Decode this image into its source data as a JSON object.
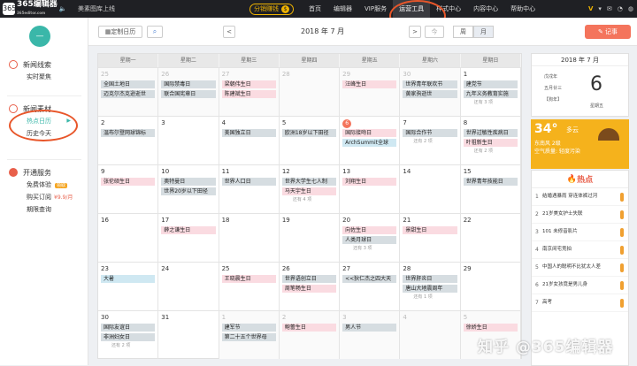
{
  "topbar": {
    "logo_mark": "365",
    "logo_text": "365编辑器",
    "logo_sub": "365editor.com",
    "notice": "美素图库上线",
    "earn_label": "分销赚钱",
    "coin": "$",
    "nav": [
      "首页",
      "编辑器",
      "VIP服务",
      "运营工具",
      "样式中心",
      "内容中心",
      "帮助中心"
    ],
    "right": {
      "vip": "V",
      "arrow": "▾"
    }
  },
  "sidebar": {
    "toggle": "—",
    "sections": [
      {
        "title": "新闻线索",
        "links": [
          "实时聚焦"
        ]
      },
      {
        "title": "新闻素材",
        "links": [
          "热点日历",
          "历史今天"
        ]
      },
      {
        "title": "开通服务",
        "links": [
          "免费体验",
          "购买订阅",
          "期限查询"
        ]
      }
    ],
    "free_badge": "领取",
    "price": "¥9.9/月"
  },
  "toolbar": {
    "custom_label": "定制日历",
    "search_icon": "⌕",
    "prev": "<",
    "month": "2018 年 7 月",
    "next": ">",
    "today": "今",
    "view_week": "周",
    "view_month": "月",
    "note": "记事"
  },
  "calendar": {
    "weekdays": [
      "星期一",
      "星期二",
      "星期三",
      "星期四",
      "星期五",
      "星期六",
      "星期日"
    ],
    "weeks": [
      [
        {
          "d": "25",
          "grey": true,
          "ev": [
            [
              "全国土地日",
              "grey"
            ],
            [
              "迈克尔杰克逊逝世",
              "grey"
            ]
          ]
        },
        {
          "d": "26",
          "grey": true,
          "ev": [
            [
              "国际禁毒日",
              "grey"
            ],
            [
              "联合国宪章日",
              "grey"
            ]
          ]
        },
        {
          "d": "27",
          "grey": true,
          "ev": [
            [
              "梁朝伟生日",
              "pink"
            ],
            [
              "陈建斌生日",
              "pink"
            ]
          ]
        },
        {
          "d": "28",
          "grey": true,
          "ev": []
        },
        {
          "d": "29",
          "grey": true,
          "ev": [
            [
              "汪峰生日",
              "pink"
            ]
          ]
        },
        {
          "d": "30",
          "grey": true,
          "ev": [
            [
              "世界青年联欢节",
              "grey"
            ],
            [
              "黄家驹逝世",
              "grey"
            ]
          ]
        },
        {
          "d": "1",
          "grey": false,
          "ev": [
            [
              "建党节",
              "grey"
            ],
            [
              "九年义务教育实施",
              "grey"
            ]
          ],
          "more": "还有 3 项"
        }
      ],
      [
        {
          "d": "2",
          "ev": [
            [
              "温布尔登网球锦标",
              "grey"
            ]
          ]
        },
        {
          "d": "3",
          "ev": []
        },
        {
          "d": "4",
          "ev": [
            [
              "美国独立日",
              "grey"
            ]
          ]
        },
        {
          "d": "5",
          "ev": [
            [
              "欧洲18岁以下田径",
              "grey"
            ]
          ]
        },
        {
          "d": "6",
          "today": true,
          "ev": [
            [
              "国际接吻日",
              "pink"
            ],
            [
              "ArchSummit全球",
              "blue"
            ]
          ]
        },
        {
          "d": "7",
          "ev": [
            [
              "国际合作节",
              "grey"
            ]
          ],
          "more": "还有 2 项"
        },
        {
          "d": "8",
          "ev": [
            [
              "世界过敏性疾病日",
              "grey"
            ],
            [
              "叶祖新生日",
              "pink"
            ]
          ],
          "more": "还有 2 项"
        }
      ],
      [
        {
          "d": "9",
          "ev": [
            [
              "张伦硕生日",
              "pink"
            ]
          ]
        },
        {
          "d": "10",
          "ev": [
            [
              "奥特曼日",
              "grey"
            ],
            [
              "世界20岁以下田径",
              "grey"
            ]
          ]
        },
        {
          "d": "11",
          "ev": [
            [
              "世界人口日",
              "grey"
            ]
          ]
        },
        {
          "d": "12",
          "ev": [
            [
              "世界大学生七人制",
              "grey"
            ],
            [
              "马天宇生日",
              "pink"
            ]
          ],
          "more": "还有 4 项"
        },
        {
          "d": "13",
          "ev": [
            [
              "刘翔生日",
              "pink"
            ]
          ]
        },
        {
          "d": "14",
          "ev": []
        },
        {
          "d": "15",
          "ev": [
            [
              "世界青年技能日",
              "grey"
            ]
          ]
        }
      ],
      [
        {
          "d": "16",
          "ev": []
        },
        {
          "d": "17",
          "ev": [
            [
              "薛之谦生日",
              "pink"
            ]
          ]
        },
        {
          "d": "18",
          "ev": []
        },
        {
          "d": "19",
          "ev": []
        },
        {
          "d": "20",
          "ev": [
            [
              "向佐生日",
              "pink"
            ],
            [
              "人类月球日",
              "grey"
            ]
          ],
          "more": "还有 3 项"
        },
        {
          "d": "21",
          "ev": [
            [
              "景甜生日",
              "pink"
            ]
          ]
        },
        {
          "d": "22",
          "ev": []
        }
      ],
      [
        {
          "d": "23",
          "ev": [
            [
              "大暑",
              "blue"
            ]
          ]
        },
        {
          "d": "24",
          "ev": []
        },
        {
          "d": "25",
          "ev": [
            [
              "王晓晨生日",
              "pink"
            ]
          ]
        },
        {
          "d": "26",
          "ev": [
            [
              "世界语创立日",
              "grey"
            ],
            [
              "周笔畅生日",
              "pink"
            ]
          ]
        },
        {
          "d": "27",
          "ev": [
            [
              "<<狄仁杰之四大天",
              "grey"
            ]
          ]
        },
        {
          "d": "28",
          "ev": [
            [
              "世界肝炎日",
              "grey"
            ],
            [
              "唐山大地震周年",
              "grey"
            ]
          ],
          "more": "还有 1 项"
        },
        {
          "d": "29",
          "ev": []
        }
      ],
      [
        {
          "d": "30",
          "ev": [
            [
              "国际友谊日",
              "grey"
            ],
            [
              "非洲妇女日",
              "grey"
            ]
          ],
          "more": "还有 2 项"
        },
        {
          "d": "31",
          "ev": []
        },
        {
          "d": "1",
          "grey": true,
          "ev": [
            [
              "建军节",
              "grey"
            ],
            [
              "第二十五个世界母",
              "grey"
            ]
          ]
        },
        {
          "d": "2",
          "grey": true,
          "ev": [
            [
              "鲍蕾生日",
              "pink"
            ]
          ]
        },
        {
          "d": "3",
          "grey": true,
          "ev": [
            [
              "男人节",
              "grey"
            ]
          ]
        },
        {
          "d": "4",
          "grey": true,
          "ev": []
        },
        {
          "d": "5",
          "grey": true,
          "ev": [
            [
              "徐娇生日",
              "pink"
            ]
          ]
        }
      ]
    ]
  },
  "datecard": {
    "title": "2018 年 7 月",
    "small": [
      "戊戌年",
      "五月廿三",
      "【狗年】"
    ],
    "day": "6",
    "weekday": "星期五"
  },
  "weather": {
    "temp": "34°",
    "cond": "多云",
    "wind": "东南风 2级",
    "air": "空气质量: 轻度污染"
  },
  "hot": {
    "title": "热点",
    "items": [
      "结婚遇暴雨 穿连体裤过河",
      "21岁美女护士失联",
      "101 未修音影片",
      "南京闵宅竞拍",
      "中国人的聪明不比犹太人差",
      "21岁女孩竟是男儿身",
      "高考"
    ]
  },
  "watermark": "知乎 @365编辑器",
  "colors": {
    "accent": "#3ab7a9",
    "note": "#f4745c",
    "highlight_circle": "#e8562a",
    "weather": "#f5b21c"
  }
}
